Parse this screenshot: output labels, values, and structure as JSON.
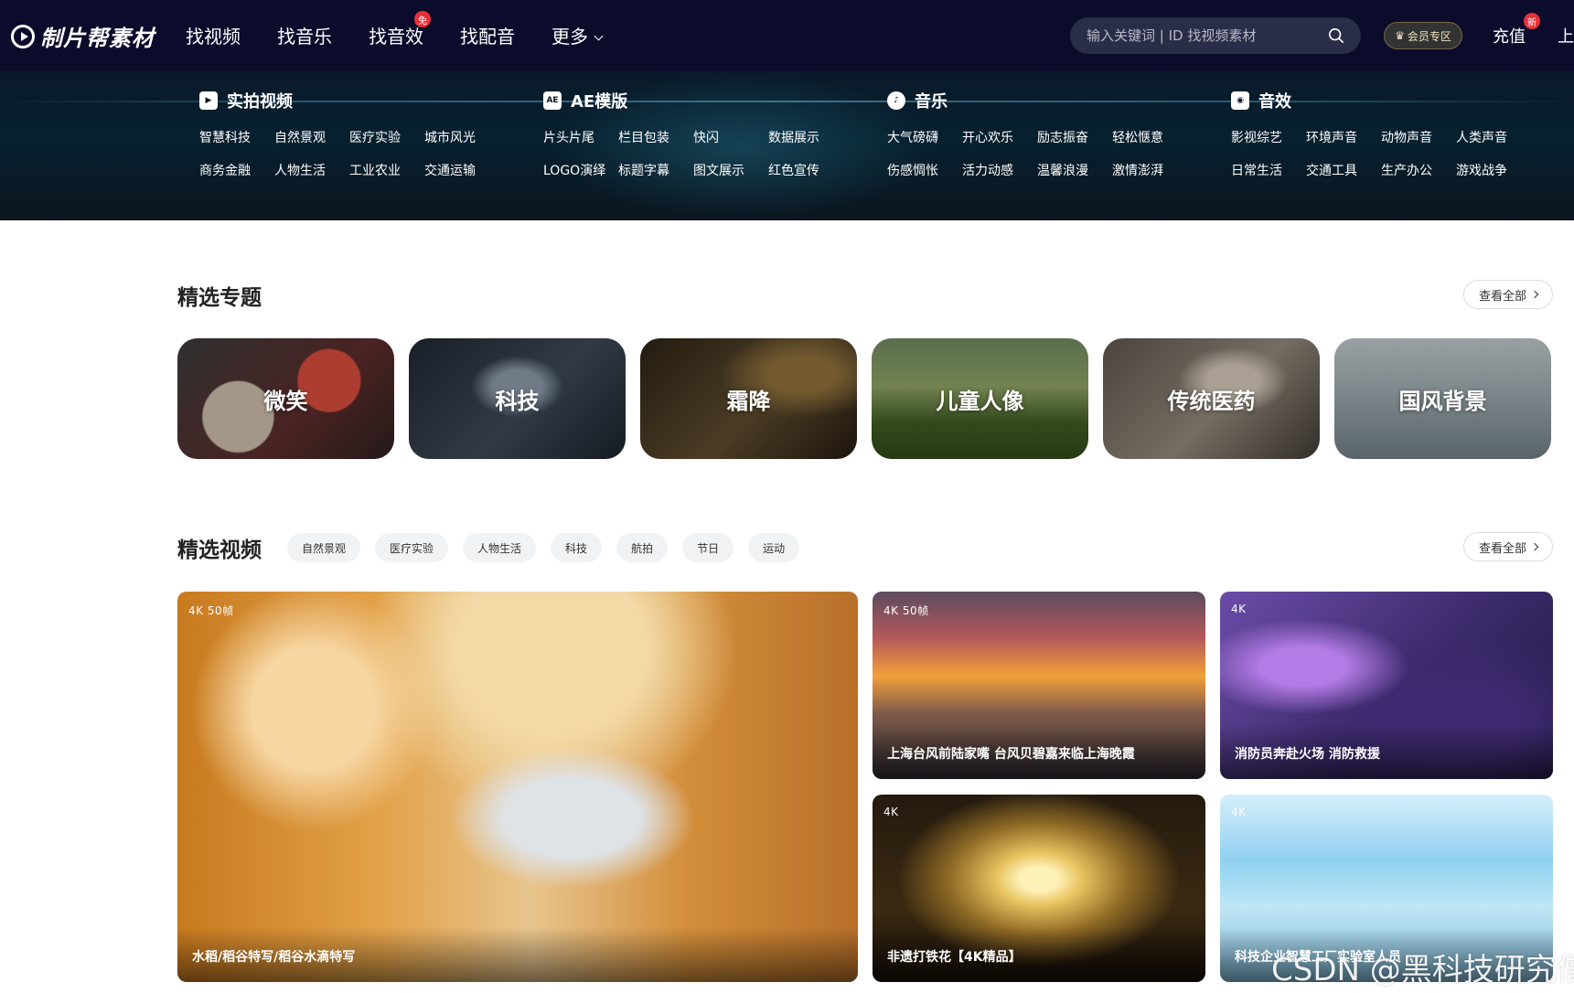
{
  "header": {
    "logo_text": "制片帮素材",
    "nav": [
      {
        "label": "找视频"
      },
      {
        "label": "找音乐"
      },
      {
        "label": "找音效",
        "badge": "免"
      },
      {
        "label": "找配音"
      },
      {
        "label": "更多"
      }
    ],
    "search_placeholder": "输入关键词 | ID 找视频素材",
    "vip_label": "会员专区",
    "recharge_label": "充值",
    "recharge_badge": "新",
    "upload_label": "上"
  },
  "mega_menu": [
    {
      "icon": "video-icon",
      "title": "实拍视频",
      "items": [
        "智慧科技",
        "自然景观",
        "医疗实验",
        "城市风光",
        "商务金融",
        "人物生活",
        "工业农业",
        "交通运输"
      ]
    },
    {
      "icon": "ae-icon",
      "icon_text": "AE",
      "title": "AE模版",
      "items": [
        "片头片尾",
        "栏目包装",
        "快闪",
        "数据展示",
        "LOGO演绎",
        "标题字幕",
        "图文展示",
        "红色宣传"
      ]
    },
    {
      "icon": "music-icon",
      "title": "音乐",
      "items": [
        "大气磅礴",
        "开心欢乐",
        "励志振奋",
        "轻松惬意",
        "伤感惆怅",
        "活力动感",
        "温馨浪漫",
        "激情澎湃"
      ]
    },
    {
      "icon": "sound-icon",
      "title": "音效",
      "items": [
        "影视综艺",
        "环境声音",
        "动物声音",
        "人类声音",
        "日常生活",
        "交通工具",
        "生产办公",
        "游戏战争"
      ]
    }
  ],
  "featured_topics": {
    "title": "精选专题",
    "view_all": "查看全部",
    "items": [
      "微笑",
      "科技",
      "霜降",
      "儿童人像",
      "传统医药",
      "国风背景"
    ]
  },
  "featured_videos": {
    "title": "精选视频",
    "view_all": "查看全部",
    "tags": [
      "自然景观",
      "医疗实验",
      "人物生活",
      "科技",
      "航拍",
      "节日",
      "运动"
    ],
    "videos": [
      {
        "res": "4K   50帧",
        "title": "水稻/稻谷特写/稻谷水滴特写"
      },
      {
        "res": "4K   50帧",
        "title": "上海台风前陆家嘴 台风贝碧嘉来临上海晚霞"
      },
      {
        "res": "4K",
        "title": "消防员奔赴火场 消防救援"
      },
      {
        "res": "4K",
        "title": "非遗打铁花【4K精品】"
      },
      {
        "res": "4K",
        "title": "科技企业智慧工厂实验室人员"
      }
    ]
  },
  "watermark": "CSDN @黑科技研究僧"
}
